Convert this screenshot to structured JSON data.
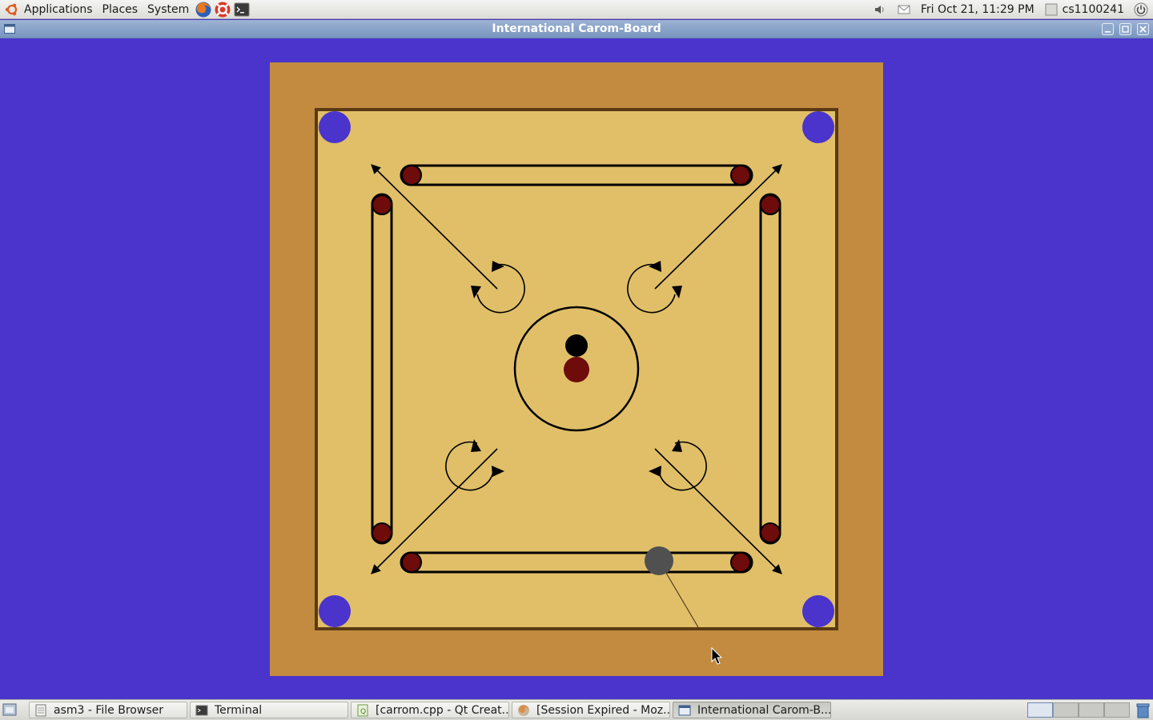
{
  "top_panel": {
    "menus": [
      "Applications",
      "Places",
      "System"
    ],
    "launchers": [
      "firefox-icon",
      "help-icon",
      "terminal-icon"
    ],
    "clock": "Fri Oct 21, 11:29 PM",
    "user": "cs1100241"
  },
  "window": {
    "title": "International Carom-Board"
  },
  "board": {
    "colors": {
      "background": "#4a34cc",
      "frame": "#c28b40",
      "surface": "#e0bf68",
      "border": "#5a3a12",
      "pockets": "#4a34cc",
      "red_circles": "#6e0b0b",
      "queen": "#6e0b0b",
      "black_coin": "#000000",
      "striker": "#505050"
    }
  },
  "taskbar": {
    "tasks": [
      "asm3 - File Browser",
      "Terminal",
      "[carrom.cpp - Qt Creat...",
      "[Session Expired - Moz...",
      "International Carom-B..."
    ],
    "active_task": "International Carom-B..."
  }
}
